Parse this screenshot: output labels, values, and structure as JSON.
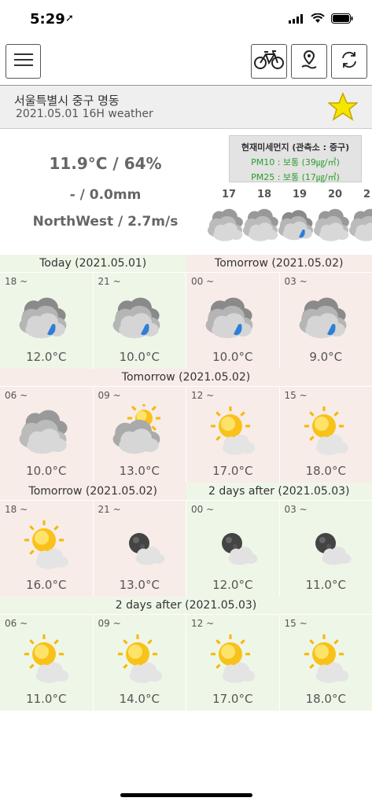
{
  "status": {
    "time": "5:29"
  },
  "header": {
    "location": "서울특별시 중구 명동",
    "subtitle": "2021.05.01 16H weather"
  },
  "summary": {
    "temp_humidity": "11.9°C / 64%",
    "rain": "- / 0.0mm",
    "wind": "NorthWest / 2.7m/s"
  },
  "dust": {
    "title": "현재미세먼지 (관측소 : 중구)",
    "pm10": "PM10 : 보통 (39㎍/㎥)",
    "pm25": "PM25 : 보통 (17㎍/㎥)"
  },
  "hours": [
    "17",
    "18",
    "19",
    "20",
    "2"
  ],
  "rows": [
    {
      "heads": [
        {
          "label": "Today (2021.05.01)",
          "span": 2,
          "bg": "green"
        },
        {
          "label": "Tomorrow (2021.05.02)",
          "span": 2,
          "bg": "pink"
        }
      ],
      "cells": [
        {
          "time": "18 ~",
          "temp": "12.0°C",
          "icon": "rain-cloud",
          "bg": "green"
        },
        {
          "time": "21 ~",
          "temp": "10.0°C",
          "icon": "rain-cloud",
          "bg": "green"
        },
        {
          "time": "00 ~",
          "temp": "10.0°C",
          "icon": "rain-cloud",
          "bg": "pink"
        },
        {
          "time": "03 ~",
          "temp": "9.0°C",
          "icon": "rain-cloud",
          "bg": "pink"
        }
      ]
    },
    {
      "heads": [
        {
          "label": "Tomorrow (2021.05.02)",
          "span": 4,
          "bg": "pink"
        }
      ],
      "cells": [
        {
          "time": "06 ~",
          "temp": "10.0°C",
          "icon": "cloudy",
          "bg": "pink"
        },
        {
          "time": "09 ~",
          "temp": "13.0°C",
          "icon": "cloudy-sun",
          "bg": "pink"
        },
        {
          "time": "12 ~",
          "temp": "17.0°C",
          "icon": "sun-cloud",
          "bg": "pink"
        },
        {
          "time": "15 ~",
          "temp": "18.0°C",
          "icon": "sun-cloud",
          "bg": "pink"
        }
      ]
    },
    {
      "heads": [
        {
          "label": "Tomorrow (2021.05.02)",
          "span": 2,
          "bg": "pink"
        },
        {
          "label": "2 days after (2021.05.03)",
          "span": 2,
          "bg": "green"
        }
      ],
      "cells": [
        {
          "time": "18 ~",
          "temp": "16.0°C",
          "icon": "sun-cloud",
          "bg": "pink"
        },
        {
          "time": "21 ~",
          "temp": "13.0°C",
          "icon": "moon-cloud",
          "bg": "pink"
        },
        {
          "time": "00 ~",
          "temp": "12.0°C",
          "icon": "moon-cloud",
          "bg": "green"
        },
        {
          "time": "03 ~",
          "temp": "11.0°C",
          "icon": "moon-cloud",
          "bg": "green"
        }
      ]
    },
    {
      "heads": [
        {
          "label": "2 days after (2021.05.03)",
          "span": 4,
          "bg": "green"
        }
      ],
      "cells": [
        {
          "time": "06 ~",
          "temp": "11.0°C",
          "icon": "sun-cloud",
          "bg": "green"
        },
        {
          "time": "09 ~",
          "temp": "14.0°C",
          "icon": "sun-cloud",
          "bg": "green"
        },
        {
          "time": "12 ~",
          "temp": "17.0°C",
          "icon": "sun-cloud",
          "bg": "green"
        },
        {
          "time": "15 ~",
          "temp": "18.0°C",
          "icon": "sun-cloud",
          "bg": "green"
        }
      ]
    }
  ]
}
